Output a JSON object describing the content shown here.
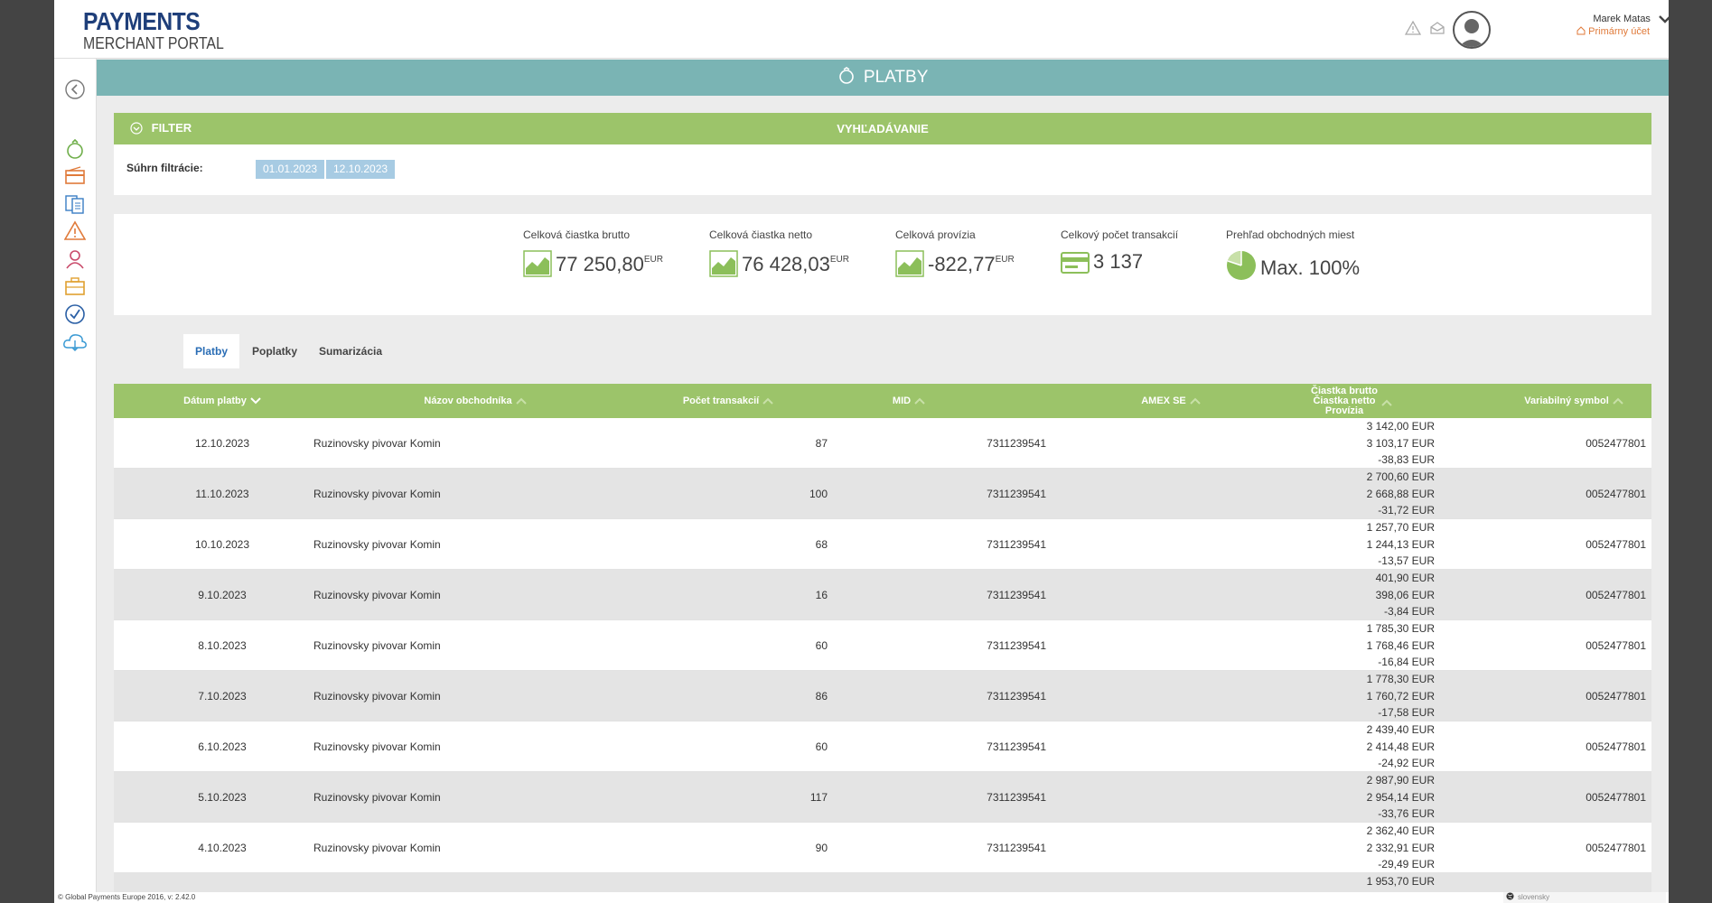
{
  "app": {
    "logo_main": "PAYMENTS",
    "logo_sub": "MERCHANT PORTAL"
  },
  "header": {
    "user_name": "Marek Matas",
    "account": "Primárny účet",
    "icons": [
      "warning-icon",
      "mail-icon",
      "avatar-icon",
      "chevron-down-icon"
    ]
  },
  "sidebar": {
    "items": [
      {
        "icon": "back-arrow-icon"
      },
      {
        "icon": "payments-icon",
        "color": "#6fae4a"
      },
      {
        "icon": "card-icon",
        "color": "#e07a3a"
      },
      {
        "icon": "documents-icon",
        "color": "#3a7ec4"
      },
      {
        "icon": "warning-icon",
        "color": "#e07a3a"
      },
      {
        "icon": "user-icon",
        "color": "#c94a6a"
      },
      {
        "icon": "briefcase-icon",
        "color": "#e0a030"
      },
      {
        "icon": "check-icon",
        "color": "#2a5fa5"
      },
      {
        "icon": "cloud-download-icon",
        "color": "#3a9ad4"
      }
    ]
  },
  "page": {
    "title": "PLATBY"
  },
  "filter": {
    "label": "FILTER",
    "search_label": "VYHĽADÁVANIE",
    "summary_label": "Súhrn filtrácie:",
    "date_from": "01.01.2023",
    "date_to": "12.10.2023"
  },
  "stats": [
    {
      "label": "Celková čiastka brutto",
      "value": "77 250,80",
      "unit": "EUR",
      "icon": "chart-icon"
    },
    {
      "label": "Celková čiastka netto",
      "value": "76 428,03",
      "unit": "EUR",
      "icon": "chart-icon"
    },
    {
      "label": "Celková provízia",
      "value": "-822,77",
      "unit": "EUR",
      "icon": "chart-icon"
    },
    {
      "label": "Celkový počet transakcií",
      "value": "3 137",
      "unit": "",
      "icon": "card-icon"
    },
    {
      "label": "Prehľad obchodných miest",
      "value": "Max. 100%",
      "unit": "",
      "icon": "pie-chart-icon"
    }
  ],
  "tabs": [
    {
      "label": "Platby",
      "active": true
    },
    {
      "label": "Poplatky",
      "active": false
    },
    {
      "label": "Sumarizácia",
      "active": false
    }
  ],
  "table": {
    "headers": {
      "date": "Dátum platby",
      "merchant": "Názov obchodníka",
      "count": "Počet transakcií",
      "mid": "MID",
      "amex": "AMEX SE",
      "brutto": "Čiastka brutto",
      "netto": "Čiastka netto",
      "fee": "Provízia",
      "vs": "Variabilný symbol"
    },
    "rows": [
      {
        "date": "12.10.2023",
        "merchant": "Ruzinovsky pivovar Komin",
        "count": "87",
        "mid": "7311239541",
        "brutto": "3 142,00 EUR",
        "netto": "3 103,17 EUR",
        "fee": "-38,83 EUR",
        "vs": "0052477801"
      },
      {
        "date": "11.10.2023",
        "merchant": "Ruzinovsky pivovar Komin",
        "count": "100",
        "mid": "7311239541",
        "brutto": "2 700,60 EUR",
        "netto": "2 668,88 EUR",
        "fee": "-31,72 EUR",
        "vs": "0052477801"
      },
      {
        "date": "10.10.2023",
        "merchant": "Ruzinovsky pivovar Komin",
        "count": "68",
        "mid": "7311239541",
        "brutto": "1 257,70 EUR",
        "netto": "1 244,13 EUR",
        "fee": "-13,57 EUR",
        "vs": "0052477801"
      },
      {
        "date": "9.10.2023",
        "merchant": "Ruzinovsky pivovar Komin",
        "count": "16",
        "mid": "7311239541",
        "brutto": "401,90 EUR",
        "netto": "398,06 EUR",
        "fee": "-3,84 EUR",
        "vs": "0052477801"
      },
      {
        "date": "8.10.2023",
        "merchant": "Ruzinovsky pivovar Komin",
        "count": "60",
        "mid": "7311239541",
        "brutto": "1 785,30 EUR",
        "netto": "1 768,46 EUR",
        "fee": "-16,84 EUR",
        "vs": "0052477801"
      },
      {
        "date": "7.10.2023",
        "merchant": "Ruzinovsky pivovar Komin",
        "count": "86",
        "mid": "7311239541",
        "brutto": "1 778,30 EUR",
        "netto": "1 760,72 EUR",
        "fee": "-17,58 EUR",
        "vs": "0052477801"
      },
      {
        "date": "6.10.2023",
        "merchant": "Ruzinovsky pivovar Komin",
        "count": "60",
        "mid": "7311239541",
        "brutto": "2 439,40 EUR",
        "netto": "2 414,48 EUR",
        "fee": "-24,92 EUR",
        "vs": "0052477801"
      },
      {
        "date": "5.10.2023",
        "merchant": "Ruzinovsky pivovar Komin",
        "count": "117",
        "mid": "7311239541",
        "brutto": "2 987,90 EUR",
        "netto": "2 954,14 EUR",
        "fee": "-33,76 EUR",
        "vs": "0052477801"
      },
      {
        "date": "4.10.2023",
        "merchant": "Ruzinovsky pivovar Komin",
        "count": "90",
        "mid": "7311239541",
        "brutto": "2 362,40 EUR",
        "netto": "2 332,91 EUR",
        "fee": "-29,49 EUR",
        "vs": "0052477801"
      },
      {
        "date": "",
        "merchant": "",
        "count": "",
        "mid": "",
        "brutto": "1 953,70 EUR",
        "netto": "",
        "fee": "",
        "vs": ""
      }
    ]
  },
  "footer": {
    "copyright": "© Global Payments Europe 2016, v: 2.42.0",
    "language": "slovensky"
  },
  "colors": {
    "brand": "#1f3f7a",
    "banner": "#7ab4b4",
    "green": "#9cc46a",
    "chip": "#a7cbe3",
    "accent": "#e07a3a",
    "active_tab": "#2a6db5"
  }
}
